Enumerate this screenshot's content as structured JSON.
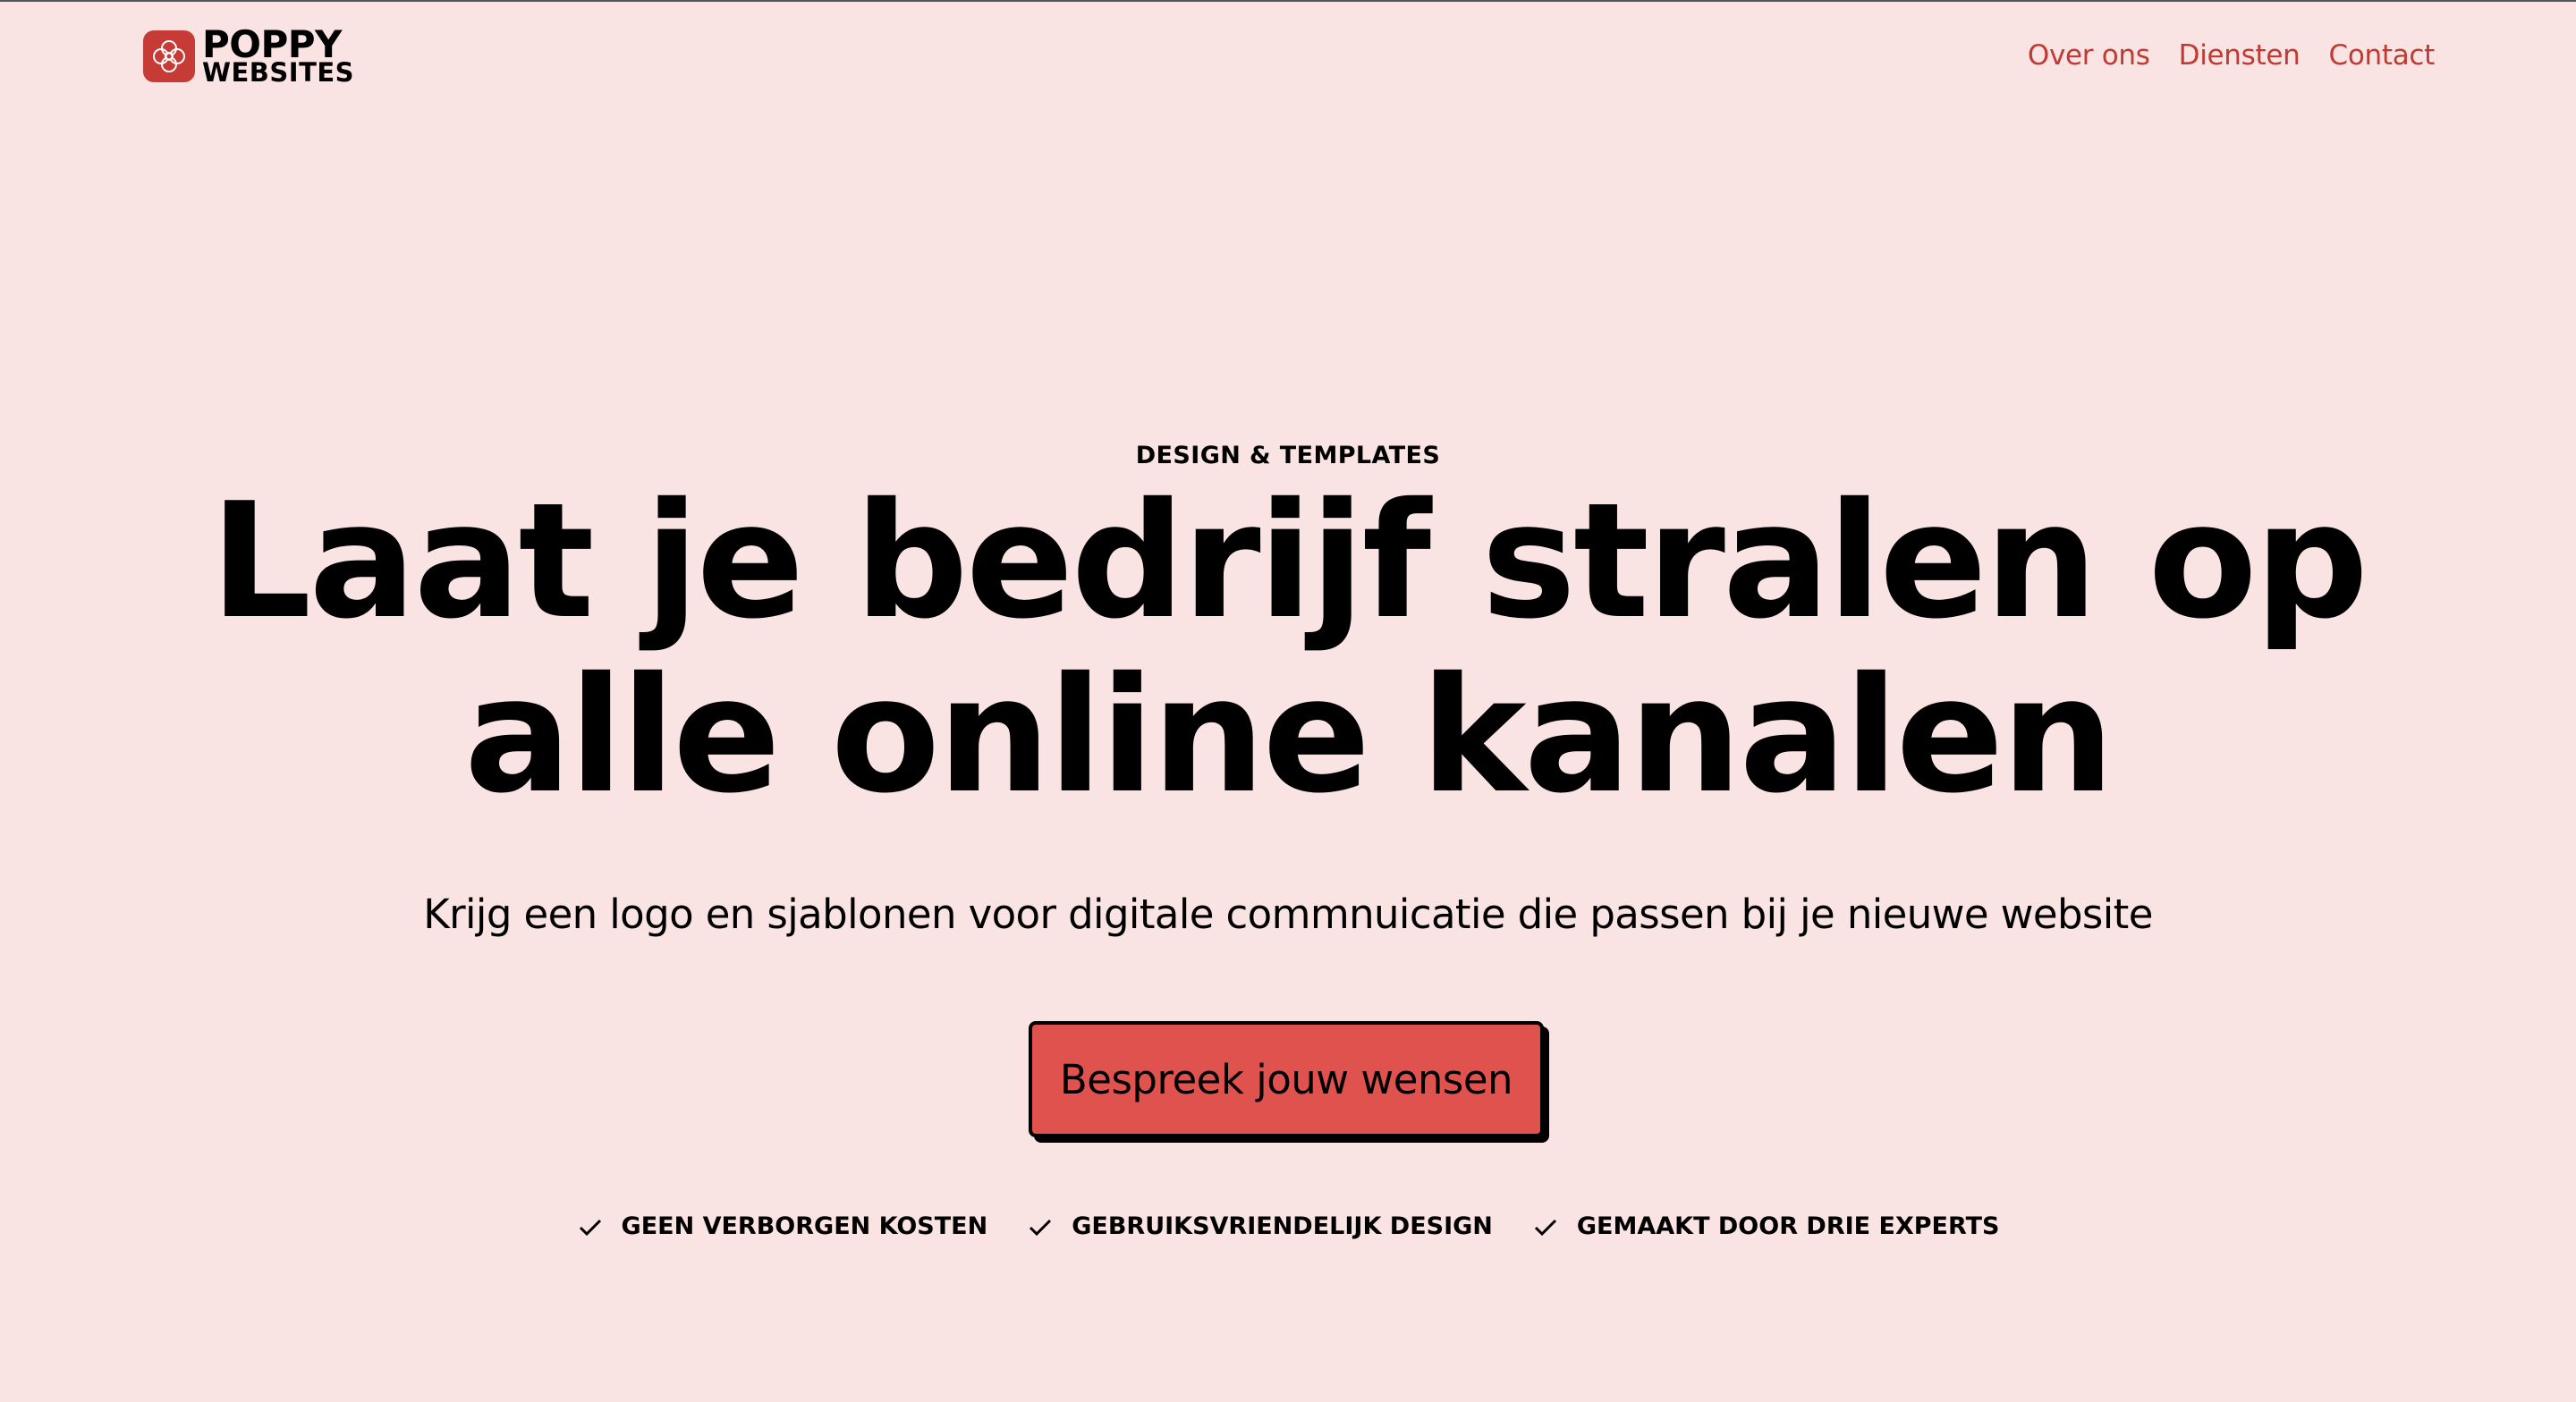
{
  "header": {
    "logo": {
      "line1": "POPPY",
      "line2": "WEBSITES",
      "icon": "poppy-flower-icon",
      "color": "#c63b36"
    },
    "nav": [
      {
        "label": "Over ons"
      },
      {
        "label": "Diensten"
      },
      {
        "label": "Contact"
      }
    ]
  },
  "hero": {
    "eyebrow": "DESIGN & TEMPLATES",
    "headline_line1": "Laat je bedrijf stralen op",
    "headline_line2": "alle online kanalen",
    "subtitle": "Krijg een logo en sjablonen voor digitale commnuicatie die passen bij je nieuwe website",
    "cta_label": "Bespreek jouw wensen",
    "features": [
      {
        "icon": "check-icon",
        "label": "GEEN VERBORGEN KOSTEN"
      },
      {
        "icon": "check-icon",
        "label": "GEBRUIKSVRIENDELIJK DESIGN"
      },
      {
        "icon": "check-icon",
        "label": "GEMAAKT DOOR DRIE EXPERTS"
      }
    ]
  },
  "colors": {
    "background": "#f9e3e3",
    "accent": "#c03a34",
    "cta": "#e0524d"
  }
}
